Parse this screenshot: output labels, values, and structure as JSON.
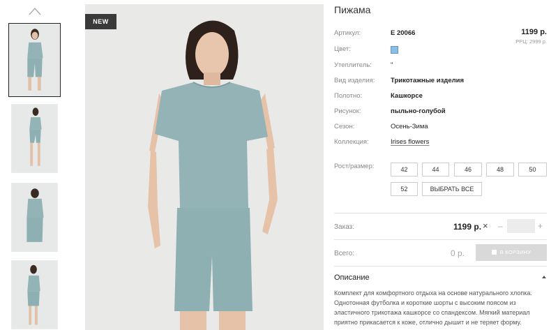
{
  "badge": "NEW",
  "product": {
    "title": "Пижама",
    "price": "1199 р.",
    "rrp": "РРЦ: 2999 р.",
    "swatch_color": "#87bfe8"
  },
  "attributes": [
    {
      "label": "Артикул:",
      "value": "Е 20066"
    },
    {
      "label": "Цвет:",
      "value": ""
    },
    {
      "label": "Утеплитель:",
      "value": "\""
    },
    {
      "label": "Вид изделия:",
      "value": "Трикотажные изделия"
    },
    {
      "label": "Полотно:",
      "value": "Кашкорсе"
    },
    {
      "label": "Рисунок:",
      "value": "пыльно-голубой"
    },
    {
      "label": "Сезон:",
      "value": "Осень-Зима"
    },
    {
      "label": "Коллекция:",
      "value": "Irises flowers"
    }
  ],
  "sizes": {
    "label": "Рост/размер:",
    "options": [
      "42",
      "44",
      "46",
      "48",
      "50",
      "52"
    ],
    "select_all": "ВЫБРАТЬ ВСЕ"
  },
  "order": {
    "label": "Заказ:",
    "price": "1199 р.",
    "times": "×",
    "minus": "–",
    "plus": "+",
    "total_label": "Всего:",
    "total_value": "0 р.",
    "cart_button": "В КОРЗИНУ"
  },
  "description": {
    "title": "Описание",
    "text": "Комплект для комфортного отдыха на основе натурального хлопка. Однотонная футболка и короткие шорты с высоким поясом из эластичного трикотажа кашкорсе со спандексом. Мягкий материал приятно прикасается к коже, отлично дышит и не теряет форму."
  }
}
